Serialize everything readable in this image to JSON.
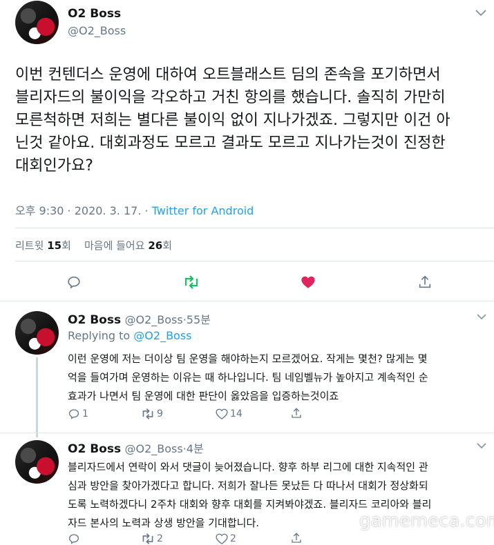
{
  "main_tweet": {
    "name": "O2 Boss",
    "handle": "@O2_Boss",
    "text_lines": [
      "이번 컨텐더스 운영에 대하여 오트블래스트 딤의 존속을 포기하면서",
      "블리자드의 불이익을 각오하고  거친 항의를 했습니다. 솔직히 가만히",
      "모른척하면 저희는 별다른 불이익 없이 지나가겠죠. 그렇지만 이건 아",
      "닌것 같아요. 대회과정도 모르고 결과도 모르고 지나가는것이 진정한",
      "대회인가요?"
    ],
    "meta_time": "오후 9:30 · 2020. 3. 17. · ",
    "meta_source": "Twitter for Android",
    "retweet_label": "리트윗",
    "retweet_count": "15",
    "retweet_unit": "회",
    "like_label": "마음에 들어요",
    "like_count": "26",
    "like_unit": "회"
  },
  "replies": [
    {
      "name": "O2 Boss",
      "handle": "@O2_Boss",
      "time": "55분",
      "replying_prefix": "Replying to ",
      "replying_handle": "@O2_Boss",
      "text_lines": [
        "이런 운영에 저는 더이상 팀 운영을 해야하는지 모르겠어요. 작게는 몇천? 많게는 몇",
        "억을 들여가며 운영하는 이유는  때 하나입니다. 팀 네임벨뉴가 높아지고 계속적인 순",
        "효과가 나면서 팀 운영에 대한 판단이 옳았음을 입증하는것이죠"
      ],
      "reply_count": "1",
      "retweet_count": "9",
      "like_count": "14"
    },
    {
      "name": "O2 Boss",
      "handle": "@O2_Boss",
      "time": "4분",
      "text_lines": [
        "블리자드에서 연락이 와서 댓글이 늦어졌습니다. 향후 하부 리그에 대한 지속적인 관",
        "심과 방안을 찾아가겠다고 합니다. 저희가 잘나든 못났든 다 따나서 대회가 정상화되",
        "도록 노력하겠다니 2주차 대회와 향후 대회를 지켜봐야겠죠.  블리자드 코리아와 블리",
        "자드 본사의 노력과 상생 방안을 기대합니다."
      ],
      "reply_count": "",
      "retweet_count": "2",
      "like_count": "2"
    }
  ],
  "watermark": "gamemeca.com",
  "colors": {
    "link": "#1da1f2",
    "retweet_green": "#17bf63",
    "like_red": "#e0245e",
    "muted": "#657786",
    "divider": "#e1e8ed"
  },
  "icons": {
    "reply": "reply-icon",
    "retweet": "retweet-icon",
    "like": "heart-icon",
    "share": "share-icon",
    "more": "chevron-down-icon"
  }
}
